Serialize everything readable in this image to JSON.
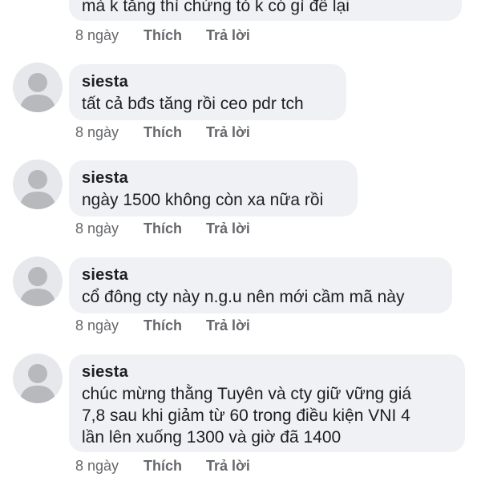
{
  "comments": [
    {
      "author": "",
      "text": "mà k tăng thì chứng tỏ k có gì để lại",
      "time": "8 ngày",
      "like_label": "Thích",
      "reply_label": "Trả lời"
    },
    {
      "author": "siesta",
      "text": "tất cả bđs tăng rồi ceo pdr tch",
      "time": "8 ngày",
      "like_label": "Thích",
      "reply_label": "Trả lời"
    },
    {
      "author": "siesta",
      "text": "ngày 1500 không còn xa nữa rồi",
      "time": "8 ngày",
      "like_label": "Thích",
      "reply_label": "Trả lời"
    },
    {
      "author": "siesta",
      "text": "cổ đông cty này n.g.u nên mới cầm mã này",
      "time": "8 ngày",
      "like_label": "Thích",
      "reply_label": "Trả lời"
    },
    {
      "author": "siesta",
      "text_lines": [
        "chúc mừng thằng Tuyên và cty giữ vững giá",
        "7,8 sau khi giảm từ 60 trong điều kiện VNI 4",
        "lần lên xuống 1300 và giờ đã 1400"
      ],
      "time": "8 ngày",
      "like_label": "Thích",
      "reply_label": "Trả lời"
    }
  ],
  "colors": {
    "bubble": "#f0f1f4",
    "avatar_bg": "#e7e8ec",
    "avatar_fg": "#b7b9bd",
    "text": "#1c1e21",
    "meta": "#65676b"
  },
  "icons": {
    "avatar": "default-user-silhouette-icon"
  }
}
